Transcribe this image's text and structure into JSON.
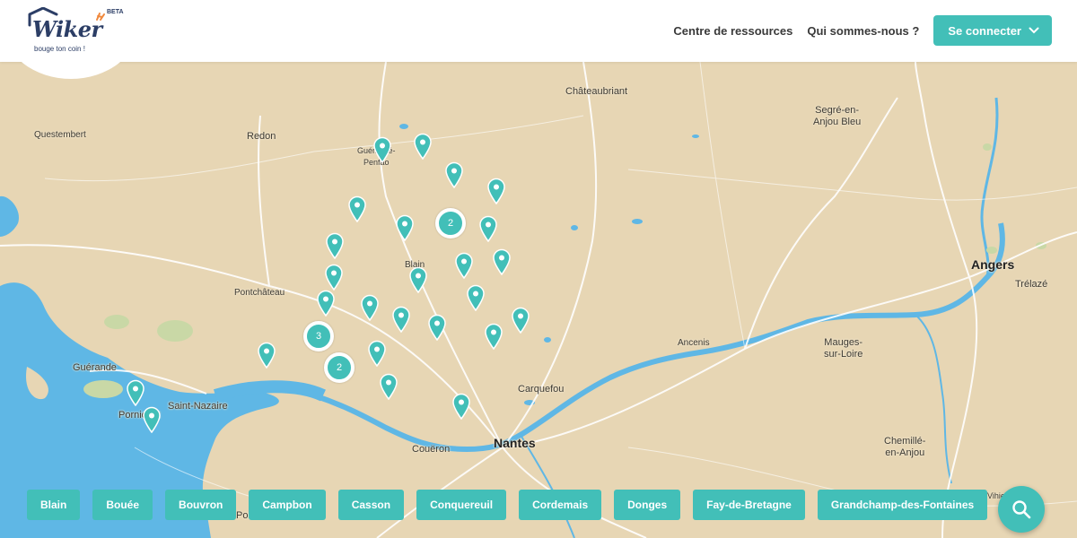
{
  "header": {
    "logo": {
      "word": "Wiker",
      "beta": "BETA",
      "tagline": "bouge ton coin !"
    },
    "nav": {
      "resources": "Centre de ressources",
      "about": "Qui sommes-nous ?",
      "connect": "Se connecter"
    }
  },
  "map": {
    "places": {
      "chateaubriant": "Châteaubriant",
      "segre": "Segré-en-\nAnjou Bleu",
      "questembert": "Questembert",
      "redon": "Redon",
      "guemene": "Guémené-\nPenfao",
      "blain": "Blain",
      "pontchateau": "Pontchâteau",
      "angers": "Angers",
      "trelaze": "Trélazé",
      "ancenis": "Ancenis",
      "mauges": "Mauges-\nsur-Loire",
      "guerande": "Guérande",
      "saint_nazaire": "Saint-Nazaire",
      "pornichet": "Pornichet",
      "carquefou": "Carquefou",
      "coueron": "Couëron",
      "nantes": "Nantes",
      "chemille": "Chemillé-\nen-Anjou",
      "vihiers": "Vihiers",
      "pornic": "Pornic"
    },
    "clusters": {
      "c1": "2",
      "c2": "3",
      "c3": "2"
    }
  },
  "chips": [
    "Blain",
    "Bouée",
    "Bouvron",
    "Campbon",
    "Casson",
    "Conquereuil",
    "Cordemais",
    "Donges",
    "Fay-de-Bretagne",
    "Grandchamp-des-Fontaines"
  ],
  "colors": {
    "accent": "#42bfb8",
    "brand": "#2c3e66",
    "water": "#5fb7e5",
    "land": "#e7d6b4"
  },
  "icons": {
    "connect_chevron": "chevron-down-icon",
    "pin": "map-pin-icon",
    "search": "search-icon"
  }
}
